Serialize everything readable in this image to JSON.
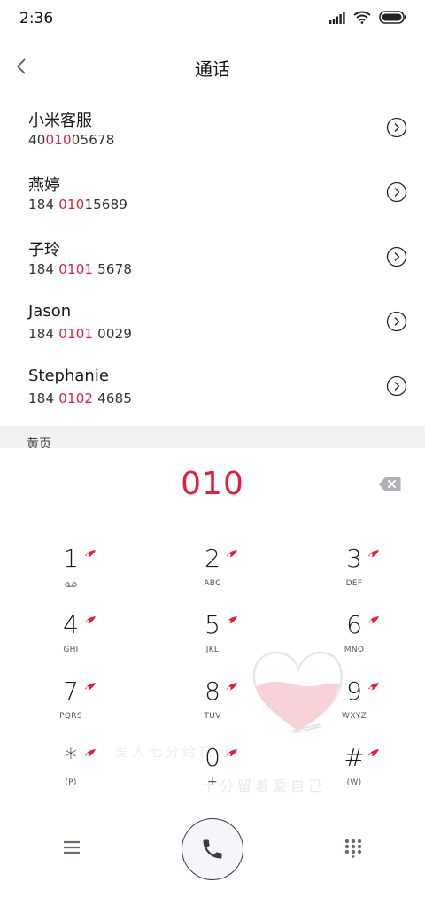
{
  "status_bar": {
    "time": "2:36"
  },
  "header": {
    "title": "通话"
  },
  "contacts": [
    {
      "name": "小米客服",
      "number_pre": "40",
      "number_hl": "010",
      "number_post": "05678"
    },
    {
      "name": "燕婷",
      "number_pre": "184 ",
      "number_hl": "010",
      "number_post": "15689"
    },
    {
      "name": "子玲",
      "number_pre": "184 ",
      "number_hl": "0101",
      "number_post": " 5678"
    },
    {
      "name": "Jason",
      "number_pre": "184 ",
      "number_hl": "0101",
      "number_post": " 0029"
    },
    {
      "name": "Stephanie",
      "number_pre": "184 ",
      "number_hl": "0102",
      "number_post": " 4685"
    }
  ],
  "section": {
    "label": "黄页"
  },
  "dialer": {
    "input_value": "010",
    "keys": [
      {
        "digit": "1",
        "sub": ""
      },
      {
        "digit": "2",
        "sub": "ABC"
      },
      {
        "digit": "3",
        "sub": "DEF"
      },
      {
        "digit": "4",
        "sub": "GHI"
      },
      {
        "digit": "5",
        "sub": "JKL"
      },
      {
        "digit": "6",
        "sub": "MNO"
      },
      {
        "digit": "7",
        "sub": "PQRS"
      },
      {
        "digit": "8",
        "sub": "TUV"
      },
      {
        "digit": "9",
        "sub": "WXYZ"
      },
      {
        "digit": "*",
        "sub": "(P)"
      },
      {
        "digit": "0",
        "sub": "+"
      },
      {
        "digit": "#",
        "sub": "(W)"
      }
    ]
  },
  "watermark": {
    "line1": "爱人七分给自己",
    "line2": "十分留着爱自己"
  },
  "colors": {
    "accent": "#e21e3c",
    "section_bg": "#f2f2f2"
  },
  "icons": {
    "back": "back-chevron-icon",
    "detail": "chevron-right-circle-icon",
    "backspace": "backspace-icon",
    "menu": "menu-icon",
    "call": "phone-icon",
    "keypad": "dialpad-icon"
  }
}
